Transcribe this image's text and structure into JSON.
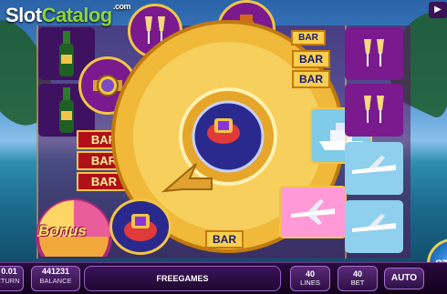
{
  "logo": {
    "slot": "Slot",
    "catalog": "Catalog",
    "domain": ".com"
  },
  "reels": {
    "bar_label": "BAR",
    "bonus_label": "Bonus"
  },
  "wheel": {
    "bar_label": "BAR"
  },
  "bottom": {
    "bet_value": "0.01",
    "bet_label": "RETURN",
    "balance_value": "441231",
    "balance_label": "BALANCE",
    "status_text": "FREEGAMES",
    "lines_value": "40",
    "lines_label": "LINES",
    "bet2_value": "40",
    "bet2_label": "BET",
    "auto_label": "AUTO",
    "spin_label": "ST"
  },
  "icons": {
    "sound": "speaker-icon",
    "symbols": [
      "champagne-bottle-icon",
      "champagne-glasses-icon",
      "gold-watch-icon",
      "cognac-icon",
      "ring-icon",
      "yacht-icon",
      "plane-icon"
    ]
  },
  "colors": {
    "gold": "#f2c548",
    "purple": "#6a1680",
    "blue_spin": "#1a76d2"
  }
}
